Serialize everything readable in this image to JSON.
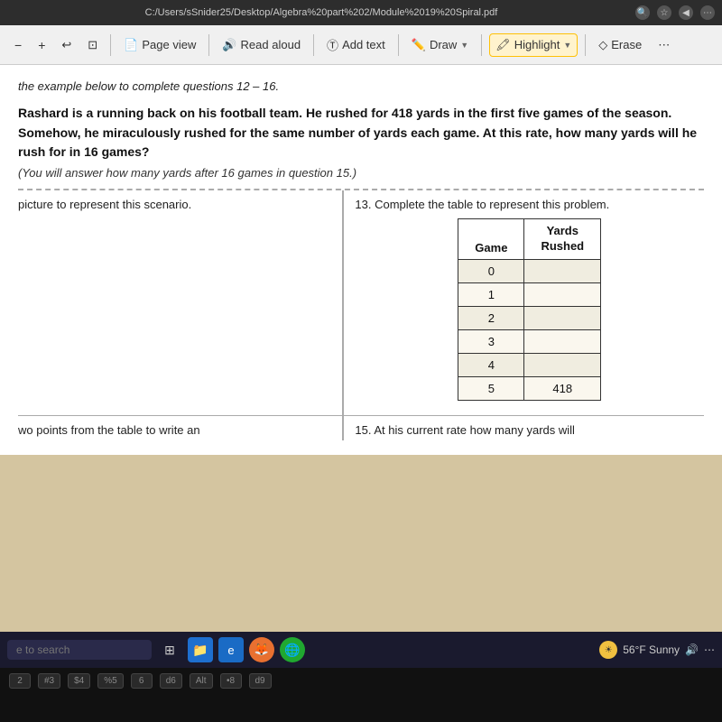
{
  "browser": {
    "url": "C:/Users/sSnider25/Desktop/Algebra%20part%202/Module%2019%20Spiral.pdf",
    "icons": [
      "search",
      "star",
      "back",
      "settings"
    ]
  },
  "toolbar": {
    "minus_label": "−",
    "plus_label": "+",
    "undo_label": "↩",
    "page_view_label": "Page view",
    "read_aloud_label": "Read aloud",
    "add_text_label": "Add text",
    "draw_label": "Draw",
    "highlight_label": "Highlight",
    "erase_label": "Erase"
  },
  "pdf": {
    "intro_text": "the example below to complete questions 12 – 16.",
    "problem_text": "Rashard is a running back on his football team.  He rushed for 418 yards in the first five games of the season.  Somehow, he miraculously rushed for the same number of yards each game.  At this rate, how many yards will he rush for in 16 games?",
    "sub_note": "(You will answer how many yards after 16 games in question 15.)",
    "q_left_12": "picture to represent this scenario.",
    "q_right_13": "13. Complete the table to represent this problem.",
    "table": {
      "headers": [
        "Game",
        "Yards\nRushed"
      ],
      "rows": [
        {
          "game": "0",
          "yards": ""
        },
        {
          "game": "1",
          "yards": ""
        },
        {
          "game": "2",
          "yards": ""
        },
        {
          "game": "3",
          "yards": ""
        },
        {
          "game": "4",
          "yards": ""
        },
        {
          "game": "5",
          "yards": "418"
        }
      ]
    },
    "q2_left_14": "wo points from the table to write an",
    "q2_right_15": "15. At his current rate how many yards will"
  },
  "taskbar": {
    "search_placeholder": "e to search",
    "weather": "56°F Sunny"
  },
  "keyboard_row": {
    "keys": [
      "2",
      "#3",
      "$4",
      "%5",
      "6",
      "d6",
      "Alt",
      "•8",
      "d9"
    ]
  }
}
